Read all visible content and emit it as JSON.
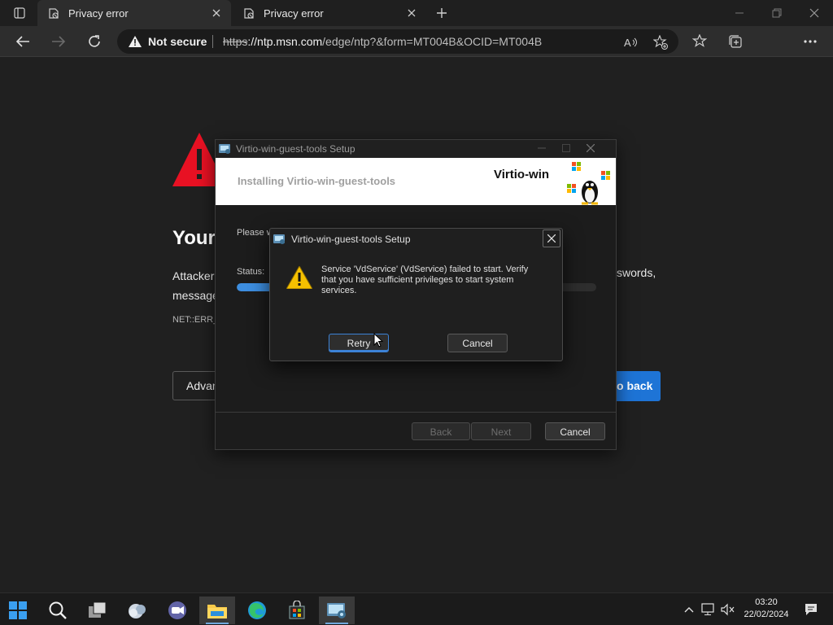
{
  "browser": {
    "tabs": [
      {
        "title": "Privacy error",
        "active": true
      },
      {
        "title": "Privacy error",
        "active": false
      }
    ],
    "address": {
      "security_label": "Not secure",
      "url_scheme": "https",
      "url_host": "://ntp.msn.com",
      "url_path": "/edge/ntp?&form=MT004B&OCID=MT004B"
    },
    "icons": {
      "back": "back-arrow-icon",
      "forward": "forward-arrow-icon",
      "refresh": "refresh-icon",
      "read_aloud": "read-aloud-icon",
      "add_favorite": "add-favorite-icon",
      "favorites": "favorites-icon",
      "collections": "collections-icon",
      "profile": "profile-icon",
      "menu": "more-menu-icon"
    }
  },
  "error_page": {
    "heading": "Your",
    "para_line1": "Attacker",
    "para_line2": "message",
    "para_right": "swords,",
    "error_code": "NET::ERR_",
    "advanced_label": "Advan",
    "back_label": "o back"
  },
  "setup": {
    "title": "Virtio-win-guest-tools Setup",
    "banner_title": "Installing Virtio-win-guest-tools",
    "brand": "Virtio-win",
    "please_wait": "Please w",
    "status_label": "Status:",
    "progress": 0.12,
    "buttons": {
      "back": "Back",
      "next": "Next",
      "cancel": "Cancel"
    }
  },
  "dialog": {
    "title": "Virtio-win-guest-tools Setup",
    "message": "Service 'VdService' (VdService) failed to start.  Verify that you have sufficient privileges to start system services.",
    "retry_label": "Retry",
    "cancel_label": "Cancel"
  },
  "taskbar": {
    "time": "03:20",
    "date": "22/02/2024",
    "apps": [
      "start-icon",
      "search-icon",
      "task-view-icon",
      "widgets-icon",
      "chat-icon",
      "file-explorer-icon",
      "edge-icon",
      "store-icon",
      "setup-app-icon"
    ]
  },
  "colors": {
    "accent": "#1e74d6",
    "warning": "#e81123",
    "background": "#202020"
  }
}
